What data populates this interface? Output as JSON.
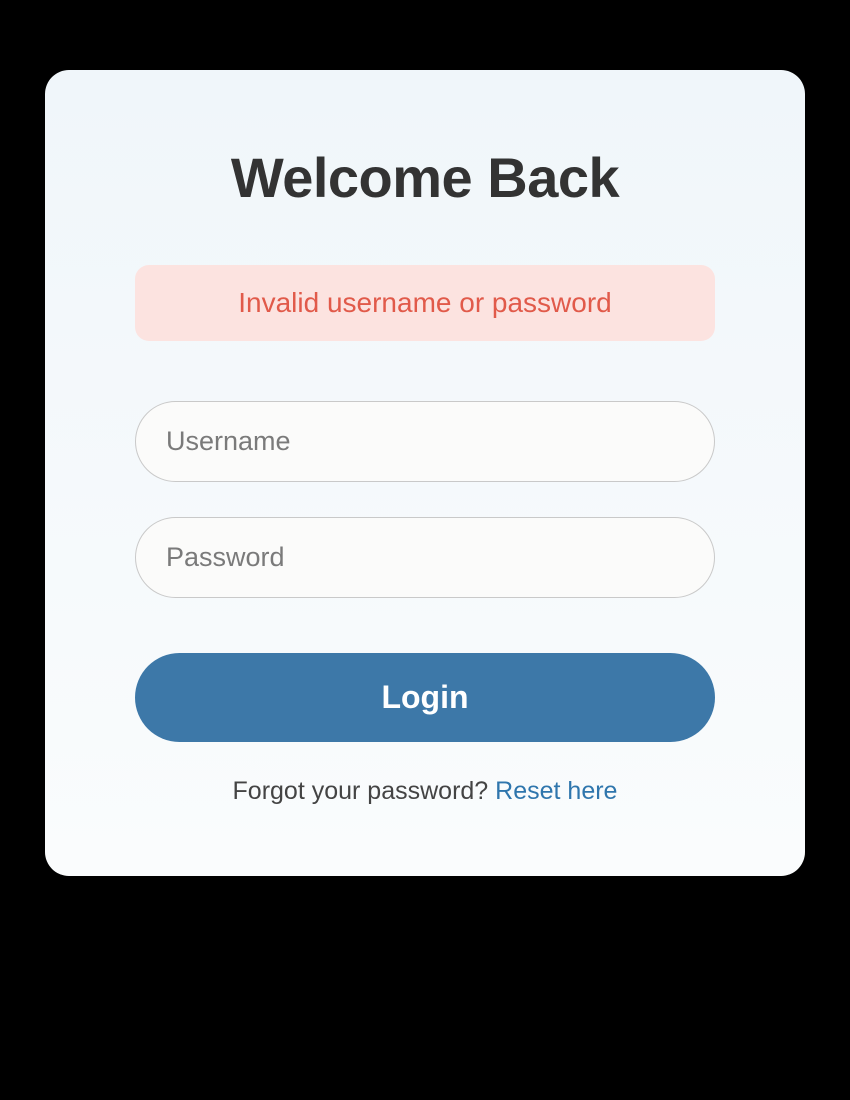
{
  "login": {
    "title": "Welcome Back",
    "error_message": "Invalid username or password",
    "username_placeholder": "Username",
    "password_placeholder": "Password",
    "login_button_label": "Login",
    "forgot_password_text": "Forgot your password? ",
    "reset_link_label": "Reset here"
  }
}
